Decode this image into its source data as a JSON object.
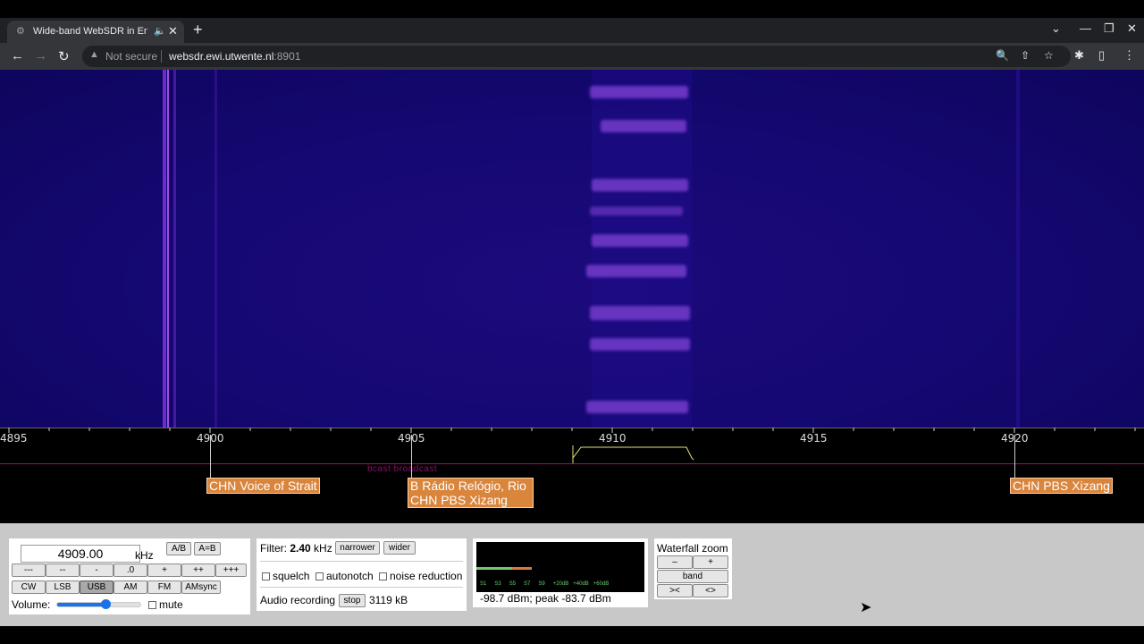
{
  "browser": {
    "tab_title": "Wide-band WebSDR in Ensch",
    "favicon": "websdr-icon",
    "new_tab": "+",
    "security": "Not secure",
    "url_host": "websdr.ewi.utwente.nl",
    "url_port": ":8901"
  },
  "waterfall": {
    "scale_labels": [
      "4895",
      "4900",
      "4905",
      "4910",
      "4915",
      "4920"
    ],
    "band_label": "bcast broadcast",
    "stations": [
      {
        "label": "CHN Voice of Strait"
      },
      {
        "label": "B Rádio Relógio, Rio",
        "label2": "CHN PBS Xizang"
      },
      {
        "label": "CHN PBS Xizang"
      }
    ]
  },
  "controls": {
    "frequency": "4909.00",
    "unit": "kHz",
    "ab_label": "A/B",
    "aeqb_label": "A=B",
    "step_buttons": [
      "---",
      "--",
      "-",
      ".0",
      "+",
      "++",
      "+++"
    ],
    "mode_buttons": [
      "CW",
      "LSB",
      "USB",
      "AM",
      "FM",
      "AMsync"
    ],
    "active_mode": "USB",
    "volume_label": "Volume:",
    "volume_level": 0.58,
    "mute_label": "mute"
  },
  "filter": {
    "label": "Filter:",
    "value": "2.40",
    "unit": "kHz",
    "narrower": "narrower",
    "wider": "wider",
    "squelch": "squelch",
    "autonotch": "autonotch",
    "noise_reduction": "noise reduction",
    "recording_label": "Audio recording",
    "stop": "stop",
    "recorded_size": "3119 kB"
  },
  "smeter": {
    "scale": [
      "S1",
      "S3",
      "S5",
      "S7",
      "S9",
      "+20dB",
      "+40dB",
      "+60dB"
    ],
    "reading": "-98.7 dBm; peak  -83.7 dBm"
  },
  "zoom": {
    "title": "Waterfall zoom",
    "minus": "–",
    "plus": "+",
    "band": "band",
    "narrow": "><",
    "wide": "<>"
  },
  "colors": {
    "waterfall_bg": "#150873",
    "station_label": "#d9853c",
    "band_line": "#a0106a"
  }
}
